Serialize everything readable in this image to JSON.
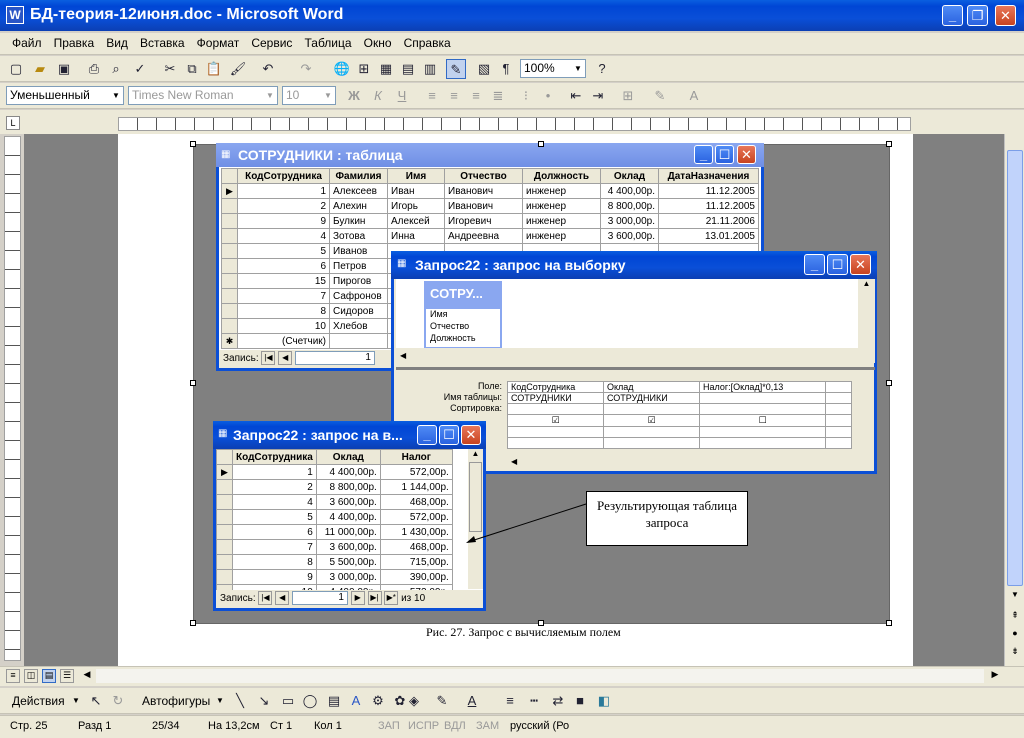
{
  "app": {
    "title": "БД-теория-12июня.doc - Microsoft Word"
  },
  "menu": [
    "Файл",
    "Правка",
    "Вид",
    "Вставка",
    "Формат",
    "Сервис",
    "Таблица",
    "Окно",
    "Справка"
  ],
  "toolbar": {
    "zoom": "100%",
    "style": "Уменьшенный",
    "font": "Times New Roman",
    "size": "10"
  },
  "employees": {
    "title": "СОТРУДНИКИ : таблица",
    "columns": [
      "КодСотрудника",
      "Фамилия",
      "Имя",
      "Отчество",
      "Должность",
      "Оклад",
      "ДатаНазначения"
    ],
    "rows": [
      [
        "1",
        "Алексеев",
        "Иван",
        "Иванович",
        "инженер",
        "4 400,00р.",
        "11.12.2005"
      ],
      [
        "2",
        "Алехин",
        "Игорь",
        "Иванович",
        "инженер",
        "8 800,00р.",
        "11.12.2005"
      ],
      [
        "9",
        "Булкин",
        "Алексей",
        "Игоревич",
        "инженер",
        "3 000,00р.",
        "21.11.2006"
      ],
      [
        "4",
        "Зотова",
        "Инна",
        "Андреевна",
        "инженер",
        "3 600,00р.",
        "13.01.2005"
      ],
      [
        "5",
        "Иванов",
        "",
        "",
        "",
        "",
        ""
      ],
      [
        "6",
        "Петров",
        "",
        "",
        "",
        "",
        ""
      ],
      [
        "15",
        "Пирогов",
        "",
        "",
        "",
        "",
        ""
      ],
      [
        "7",
        "Сафронов",
        "",
        "",
        "",
        "",
        ""
      ],
      [
        "8",
        "Сидоров",
        "",
        "",
        "",
        "",
        ""
      ],
      [
        "10",
        "Хлебов",
        "",
        "",
        "",
        "",
        ""
      ]
    ],
    "new_row": "(Счетчик)",
    "record_label": "Запись:",
    "record_num": "1"
  },
  "query_design": {
    "title": "Запрос22 : запрос на выборку",
    "table_box_title": "СОТРУ...",
    "fields": [
      "Имя",
      "Отчество",
      "Должность"
    ],
    "row_labels": [
      "Поле:",
      "Имя таблицы:",
      "Сортировка:",
      "Вывод на экран:",
      "Условие отбора:",
      "или:"
    ],
    "row_labels_visible": [
      "Поле:",
      "Имя таблицы:",
      "Сортировка:",
      "ан:",
      "ра:",
      "ли:"
    ],
    "cols": [
      {
        "field": "КодСотрудника",
        "table": "СОТРУДНИКИ",
        "show": "☑"
      },
      {
        "field": "Оклад",
        "table": "СОТРУДНИКИ",
        "show": "☑"
      },
      {
        "field": "Налог:[Оклад]*0,13",
        "table": "",
        "show": "☐"
      }
    ]
  },
  "result": {
    "title": "Запрос22 : запрос на в...",
    "columns": [
      "КодСотрудника",
      "Оклад",
      "Налог"
    ],
    "rows": [
      [
        "1",
        "4 400,00р.",
        "572,00р."
      ],
      [
        "2",
        "8 800,00р.",
        "1 144,00р."
      ],
      [
        "4",
        "3 600,00р.",
        "468,00р."
      ],
      [
        "5",
        "4 400,00р.",
        "572,00р."
      ],
      [
        "6",
        "11 000,00р.",
        "1 430,00р."
      ],
      [
        "7",
        "3 600,00р.",
        "468,00р."
      ],
      [
        "8",
        "5 500,00р.",
        "715,00р."
      ],
      [
        "9",
        "3 000,00р.",
        "390,00р."
      ],
      [
        "10",
        "4 400,00р.",
        "572,00р."
      ]
    ],
    "record_label": "Запись:",
    "record_num": "1",
    "of_label": "из",
    "total": "10"
  },
  "callout": {
    "text": "Результирующая таблица запроса"
  },
  "caption": "Рис. 27. Запрос с вычисляемым полем",
  "drawing": {
    "actions": "Действия",
    "autoshapes": "Автофигуры"
  },
  "status": {
    "page": "Стр. 25",
    "section": "Разд 1",
    "pages": "25/34",
    "at": "На 13,2см",
    "line": "Ст 1",
    "col": "Кол 1",
    "rec": "ЗАП",
    "trk": "ИСПР",
    "ext": "ВДЛ",
    "ovr": "ЗАМ",
    "lang": "русский (Ро"
  }
}
